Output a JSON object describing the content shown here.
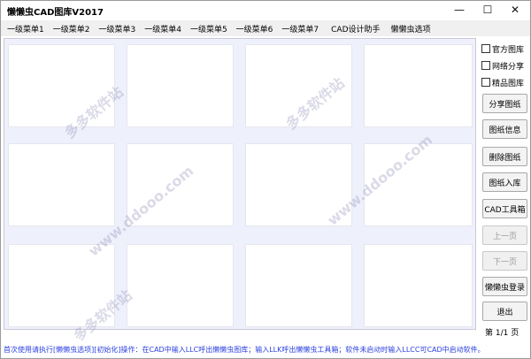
{
  "window": {
    "title": "懒懒虫CAD图库V2017",
    "minimize_glyph": "—",
    "maximize_glyph": "☐",
    "close_glyph": "✕"
  },
  "menubar": {
    "items": [
      {
        "label": "一级菜单1"
      },
      {
        "label": "一级菜单2"
      },
      {
        "label": "一级菜单3"
      },
      {
        "label": "一级菜单4"
      },
      {
        "label": "一级菜单5"
      },
      {
        "label": "一级菜单6"
      },
      {
        "label": "一级菜单7"
      },
      {
        "label": "CAD设计助手"
      },
      {
        "label": "懒懒虫选项"
      }
    ]
  },
  "gallery": {
    "thumbnails": [
      {},
      {},
      {},
      {},
      {},
      {},
      {},
      {},
      {},
      {},
      {},
      {}
    ],
    "watermarks": [
      "多多软件站",
      "www.ddooo.com",
      "多多软件站",
      "www.ddooo.com",
      "多多软件站"
    ]
  },
  "sidebar": {
    "checkboxes": [
      {
        "label": "官方图库",
        "checked": false
      },
      {
        "label": "网络分享",
        "checked": false
      },
      {
        "label": "精品图库",
        "checked": false
      }
    ],
    "buttons": {
      "share": "分享图纸",
      "info": "图纸信息",
      "delete": "删除图纸",
      "import": "图纸入库",
      "toolbox": "CAD工具箱",
      "prev": "上一页",
      "next": "下一页",
      "login": "懒懒虫登录",
      "exit": "退出"
    },
    "page_indicator": "第 1/1 页"
  },
  "statusbar": {
    "text": "首次使用请执行[懒懒虫选项][初始化]操作：在CAD中输入LLC呼出懒懒虫图库；输入LLK呼出懒懒虫工具箱；软件未启动时输入LLCC可CAD中启动软件。"
  }
}
